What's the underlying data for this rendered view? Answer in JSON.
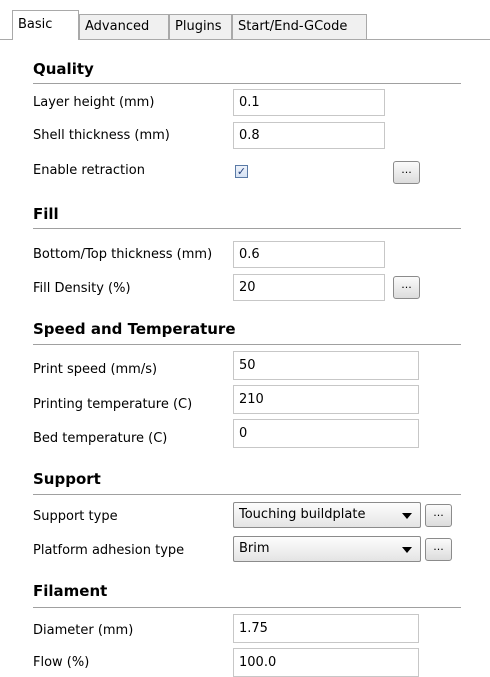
{
  "tabs": [
    "Basic",
    "Advanced",
    "Plugins",
    "Start/End-GCode"
  ],
  "active_tab": "Basic",
  "more_button_label": "...",
  "quality": {
    "title": "Quality",
    "layer_height_label": "Layer height (mm)",
    "layer_height_value": "0.1",
    "shell_thickness_label": "Shell thickness (mm)",
    "shell_thickness_value": "0.8",
    "enable_retraction_label": "Enable retraction",
    "enable_retraction_checked": true
  },
  "fill": {
    "title": "Fill",
    "bottom_top_label": "Bottom/Top thickness (mm)",
    "bottom_top_value": "0.6",
    "fill_density_label": "Fill Density (%)",
    "fill_density_value": "20"
  },
  "speed": {
    "title": "Speed and Temperature",
    "print_speed_label": "Print speed (mm/s)",
    "print_speed_value": "50",
    "print_temp_label": "Printing temperature (C)",
    "print_temp_value": "210",
    "bed_temp_label": "Bed temperature (C)",
    "bed_temp_value": "0"
  },
  "support": {
    "title": "Support",
    "support_type_label": "Support type",
    "support_type_value": "Touching buildplate",
    "adhesion_label": "Platform adhesion type",
    "adhesion_value": "Brim"
  },
  "filament": {
    "title": "Filament",
    "diameter_label": "Diameter (mm)",
    "diameter_value": "1.75",
    "flow_label": "Flow (%)",
    "flow_value": "100.0"
  }
}
